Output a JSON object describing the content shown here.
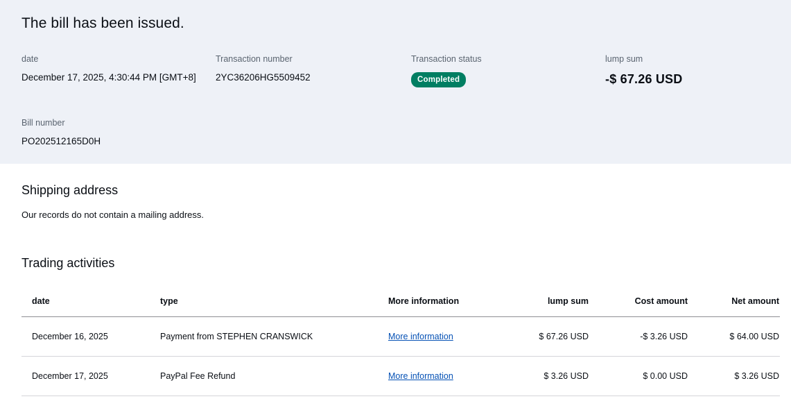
{
  "page": {
    "title": "The bill has been issued."
  },
  "summary": {
    "fields": [
      {
        "label": "date",
        "value": "December 17, 2025, 4:30:44 PM [GMT+8]"
      },
      {
        "label": "Transaction number",
        "value": "2YC36206HG5509452"
      },
      {
        "label": "Transaction status",
        "value": "Completed"
      },
      {
        "label": "lump sum",
        "value": "-$ 67.26 USD"
      },
      {
        "label": "Bill number",
        "value": "PO202512165D0H"
      }
    ]
  },
  "shipping": {
    "heading": "Shipping address",
    "message": "Our records do not contain a mailing address."
  },
  "activities": {
    "heading": "Trading activities",
    "columns": [
      "date",
      "type",
      "More information",
      "lump sum",
      "Cost amount",
      "Net amount"
    ],
    "rows": [
      {
        "date": "December 16, 2025",
        "type": "Payment from STEPHEN CRANSWICK",
        "more_info": "More information",
        "lump_sum": "$ 67.26 USD",
        "cost_amount": "-$ 3.26 USD",
        "net_amount": "$ 64.00 USD"
      },
      {
        "date": "December 17, 2025",
        "type": "PayPal Fee Refund",
        "more_info": "More information",
        "lump_sum": "$ 3.26 USD",
        "cost_amount": "$ 0.00 USD",
        "net_amount": "$ 3.26 USD"
      }
    ]
  },
  "colors": {
    "status_completed_bg": "#017e62",
    "status_completed_text": "#ffffff",
    "link_blue": "#0551b5",
    "hero_background": "#eef1f7",
    "table_header_border": "#8e8e93",
    "table_row_border": "#d4d4d9"
  }
}
